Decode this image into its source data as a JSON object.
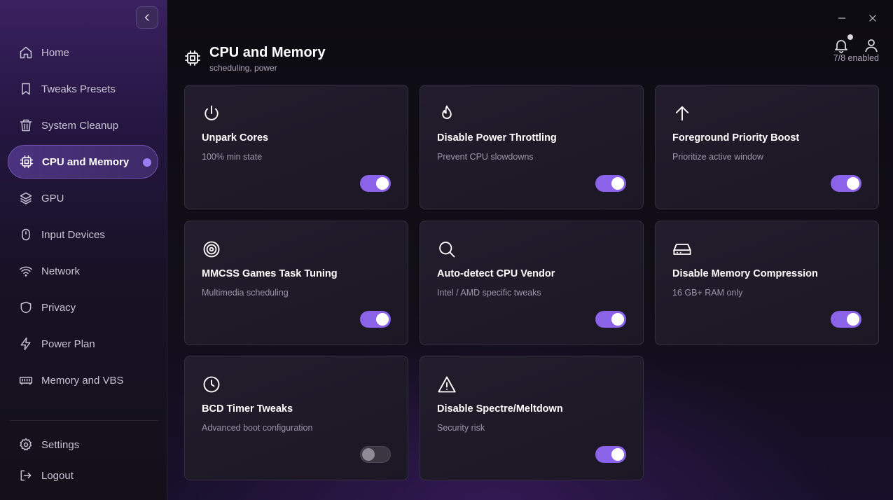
{
  "sidebar": {
    "items": [
      {
        "label": "Home",
        "icon": "home-icon"
      },
      {
        "label": "Tweaks Presets",
        "icon": "bookmark-icon"
      },
      {
        "label": "System Cleanup",
        "icon": "trash-icon"
      },
      {
        "label": "CPU and Memory",
        "icon": "cpu-icon",
        "active": true
      },
      {
        "label": "GPU",
        "icon": "layers-icon"
      },
      {
        "label": "Input Devices",
        "icon": "mouse-icon"
      },
      {
        "label": "Network",
        "icon": "wifi-icon"
      },
      {
        "label": "Privacy",
        "icon": "shield-icon"
      },
      {
        "label": "Power Plan",
        "icon": "lightning-icon"
      },
      {
        "label": "Memory and VBS",
        "icon": "memory-stick-icon"
      }
    ],
    "bottom": [
      {
        "label": "Settings",
        "icon": "gear-icon"
      },
      {
        "label": "Logout",
        "icon": "logout-icon"
      }
    ]
  },
  "header": {
    "title": "CPU and Memory",
    "subtitle": "scheduling, power",
    "enabled_count": "7/8 enabled"
  },
  "cards": [
    {
      "title": "Unpark Cores",
      "desc": "100% min state",
      "icon": "power-icon",
      "enabled": true
    },
    {
      "title": "Disable Power Throttling",
      "desc": "Prevent CPU slowdowns",
      "icon": "flame-icon",
      "enabled": true
    },
    {
      "title": "Foreground Priority Boost",
      "desc": "Prioritize active window",
      "icon": "arrow-up-icon",
      "enabled": true
    },
    {
      "title": "MMCSS Games Task Tuning",
      "desc": "Multimedia scheduling",
      "icon": "target-icon",
      "enabled": true
    },
    {
      "title": "Auto-detect CPU Vendor",
      "desc": "Intel / AMD specific tweaks",
      "icon": "search-icon",
      "enabled": true
    },
    {
      "title": "Disable Memory Compression",
      "desc": "16 GB+ RAM only",
      "icon": "hard-drive-icon",
      "enabled": true
    },
    {
      "title": "BCD Timer Tweaks",
      "desc": "Advanced boot configuration",
      "icon": "clock-icon",
      "enabled": false
    },
    {
      "title": "Disable Spectre/Meltdown",
      "desc": "Security risk",
      "icon": "warning-icon",
      "enabled": true
    }
  ],
  "colors": {
    "accent": "#8b63e8",
    "active_nav": "#4c327f",
    "dot": "#9a7ff2"
  }
}
